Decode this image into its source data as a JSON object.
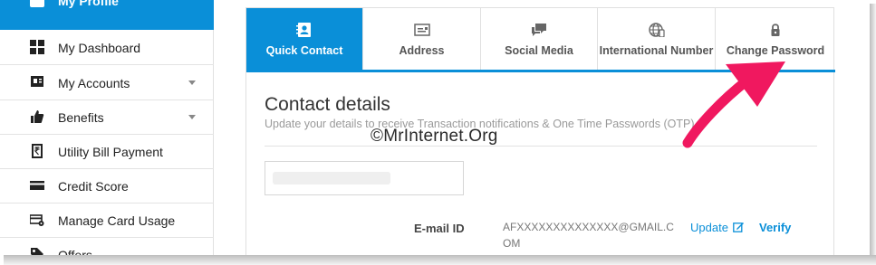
{
  "sidebar": {
    "profile_label": "My Profile",
    "items": [
      {
        "label": "My Dashboard",
        "icon": "dashboard-icon",
        "has_caret": false
      },
      {
        "label": "My Accounts",
        "icon": "accounts-icon",
        "has_caret": true
      },
      {
        "label": "Benefits",
        "icon": "thumbs-up-icon",
        "has_caret": true
      },
      {
        "label": "Utility Bill Payment",
        "icon": "rupee-bill-icon",
        "has_caret": false
      },
      {
        "label": "Credit Score",
        "icon": "credit-card-icon",
        "has_caret": false
      },
      {
        "label": "Manage Card Usage",
        "icon": "card-settings-icon",
        "has_caret": false
      },
      {
        "label": "Offers",
        "icon": "tag-icon",
        "has_caret": false
      }
    ]
  },
  "tabs": [
    {
      "label": "Quick Contact",
      "icon": "contact-card-icon",
      "active": true
    },
    {
      "label": "Address",
      "icon": "address-card-icon",
      "active": false
    },
    {
      "label": "Social Media",
      "icon": "chat-bubbles-icon",
      "active": false
    },
    {
      "label": "International Number",
      "icon": "globe-phone-icon",
      "active": false
    },
    {
      "label": "Change Password",
      "icon": "lock-icon",
      "active": false
    }
  ],
  "content": {
    "title": "Contact details",
    "subtitle": "Update your details to receive Transaction notifications & One Time Passwords (OTP).",
    "email_label": "E-mail ID",
    "email_value": "AFXXXXXXXXXXXXXX@GMAIL.COM",
    "update_label": "Update",
    "verify_label": "Verify"
  },
  "watermark": "©MrInternet.Org",
  "colors": {
    "accent": "#0a8fd8",
    "arrow": "#f0185f"
  }
}
